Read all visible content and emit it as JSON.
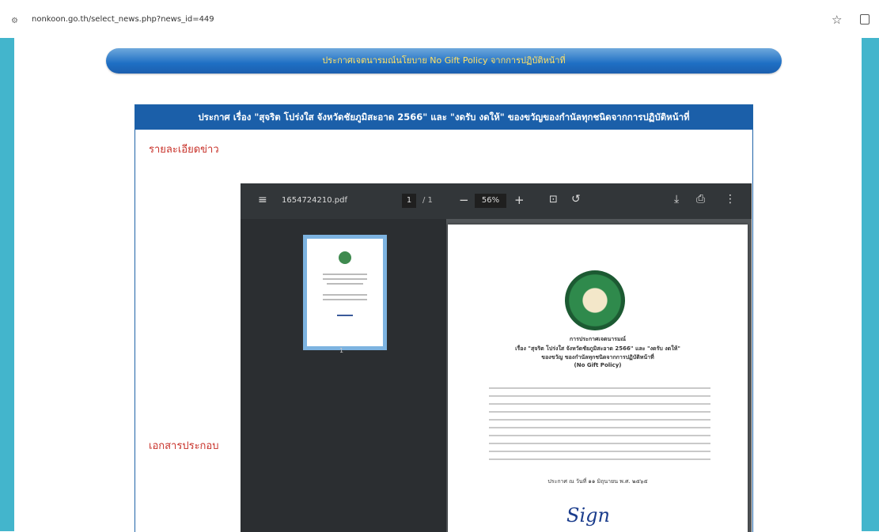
{
  "browser": {
    "url": "nonkoon.go.th/select_news.php?news_id=449",
    "left_icon": "site-info-icon",
    "star_icon": "bookmark-star-icon",
    "extension_icon": "extensions-icon"
  },
  "banner": {
    "text": "ประกาศเจตนารมณ์นโยบาย No Gift Policy จากการปฏิบัติหน้าที่"
  },
  "news": {
    "header": "ประกาศ เรื่อง \"สุจริต โปร่งใส จังหวัดชัยภูมิสะอาด 2566\" และ \"งดรับ งดให้\" ของขวัญของกำนัลทุกชนิดจากการปฏิบัติหน้าที่",
    "details_label": "รายละเอียดข่าว",
    "attachments_label": "เอกสารประกอบ"
  },
  "pdf_viewer": {
    "filename": "1654724210.pdf",
    "current_page": "1",
    "total_pages": "/ 1",
    "zoom": "56%",
    "zoom_minus": "−",
    "zoom_plus": "+",
    "thumbnail_page": "1"
  },
  "document": {
    "heading": "การประกาศเจตนารมณ์",
    "title_line1": "เรื่อง \"สุจริต โปร่งใส จังหวัดชัยภูมิสะอาด 2566\" และ \"งดรับ งดให้\"",
    "title_line2": "ของขวัญ ของกำนัลทุกชนิดจากการปฏิบัติหน้าที่",
    "policy": "(No Gift Policy)",
    "date": "ประกาศ ณ วันที่ ๑๑ มิถุนายน พ.ศ. ๒๕๖๕",
    "signature": "Sign"
  },
  "colors": {
    "side_accent": "#43b5cc",
    "header_blue": "#1b5fa9",
    "label_red": "#c8322a",
    "banner_text": "#ffe066"
  }
}
